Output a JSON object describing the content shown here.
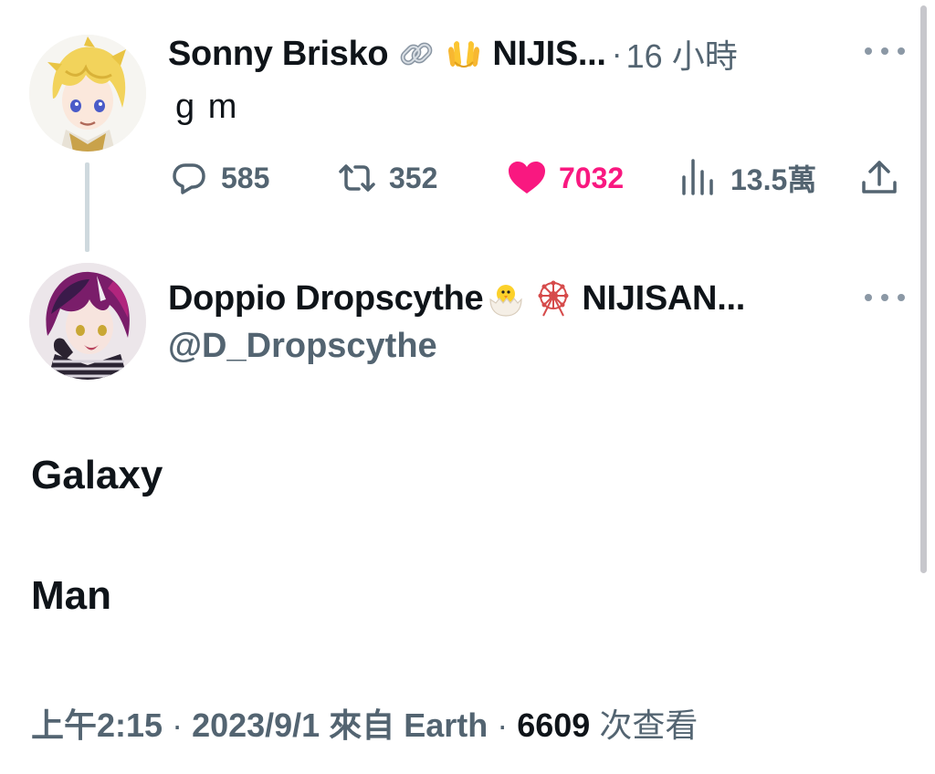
{
  "reply_tweet": {
    "display_name": "Sonny Brisko",
    "emoji_1": "link-icon",
    "emoji_2": "open-hands-icon",
    "nickname_truncated": "NIJIS...",
    "separator": "·",
    "time_ago": "16 小時",
    "text": "g m",
    "actions": {
      "replies": "585",
      "retweets": "352",
      "likes": "7032",
      "views": "13.5萬"
    },
    "like_color": "#f91880"
  },
  "main_tweet": {
    "display_name": "Doppio Dropscythe",
    "emoji_1": "hatching-chick-icon",
    "emoji_2": "ferris-wheel-icon",
    "nickname_truncated": "NIJISAN...",
    "handle": "@D_Dropscythe",
    "lines": [
      "Galaxy",
      "Man"
    ],
    "meta": {
      "time": "上午2:15",
      "dot_1": " · ",
      "date": "2023/9/1",
      "via": " 來自 Earth",
      "dot_2": " · ",
      "views_count": "6609",
      "views_label": " 次查看"
    }
  },
  "colors": {
    "text_primary": "#0f1419",
    "text_secondary": "#536471",
    "thread_line": "#cfd9de"
  }
}
